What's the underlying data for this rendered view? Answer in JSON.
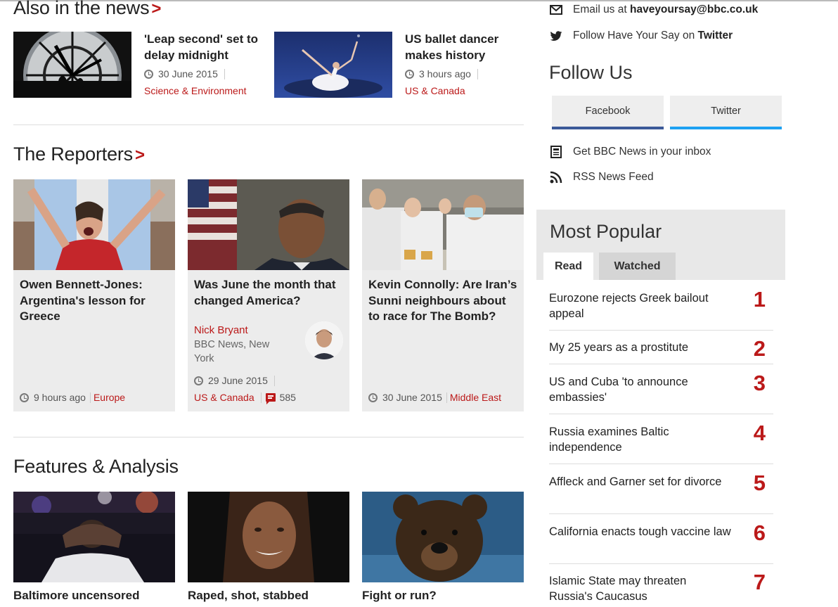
{
  "also": {
    "heading": "Also in the news",
    "items": [
      {
        "title": "'Leap second' set to delay midnight",
        "time": "30 June 2015",
        "category": "Science & Environment"
      },
      {
        "title": "US ballet dancer makes history",
        "time": "3 hours ago",
        "category": "US & Canada"
      }
    ]
  },
  "reporters": {
    "heading": "The Reporters",
    "cards": [
      {
        "title": "Owen Bennett-Jones: Argentina's lesson for Greece",
        "time": "9 hours ago",
        "category": "Europe"
      },
      {
        "title": "Was June the month that changed America?",
        "author": "Nick Bryant",
        "author_role": "BBC News, New York",
        "time": "29 June 2015",
        "category": "US & Canada",
        "comments": "585"
      },
      {
        "title": "Kevin Connolly: Are Iran’s Sunni neighbours about to race for The Bomb?",
        "time": "30 June 2015",
        "category": "Middle East"
      }
    ]
  },
  "features": {
    "heading": "Features & Analysis",
    "items": [
      {
        "title": "Baltimore uncensored"
      },
      {
        "title": "Raped, shot, stabbed"
      },
      {
        "title": "Fight or run?"
      }
    ]
  },
  "sidebar": {
    "email_prefix": "Email us at ",
    "email_address": "haveyoursay@bbc.co.uk",
    "twitter_prefix": "Follow Have Your Say on ",
    "twitter_name": "Twitter",
    "follow_heading": "Follow Us",
    "facebook_label": "Facebook",
    "twitter_label": "Twitter",
    "facebook_color": "#3b5998",
    "twitter_color": "#1da1f2",
    "inbox_label": "Get BBC News in your inbox",
    "rss_label": "RSS News Feed"
  },
  "most_popular": {
    "heading": "Most Popular",
    "tabs": [
      "Read",
      "Watched"
    ],
    "items": [
      {
        "title": "Eurozone rejects Greek bailout appeal",
        "rank": "1"
      },
      {
        "title": "My 25 years as a prostitute",
        "rank": "2"
      },
      {
        "title": "US and Cuba 'to announce embassies'",
        "rank": "3"
      },
      {
        "title": "Russia examines Baltic independence",
        "rank": "4"
      },
      {
        "title": "Affleck and Garner set for divorce",
        "rank": "5"
      },
      {
        "title": "California enacts tough vaccine law",
        "rank": "6"
      },
      {
        "title": "Islamic State may threaten Russia's Caucasus",
        "rank": "7"
      }
    ]
  },
  "colors": {
    "accent": "#bb1919"
  }
}
